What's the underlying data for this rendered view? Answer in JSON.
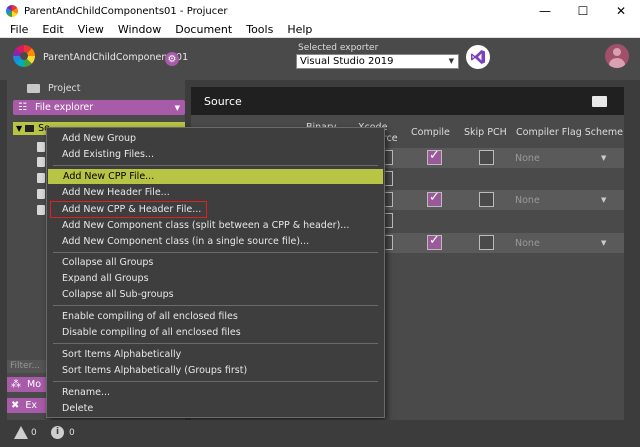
{
  "window": {
    "title": "ParentAndChildComponents01 - Projucer",
    "min": "—",
    "max": "☐",
    "close": "✕"
  },
  "menu": [
    "File",
    "Edit",
    "View",
    "Window",
    "Document",
    "Tools",
    "Help"
  ],
  "header": {
    "project_name": "ParentAndChildComponents01",
    "exporter_label": "Selected exporter",
    "exporter_value": "Visual Studio 2019"
  },
  "sidebar": {
    "project_label": "Project",
    "file_explorer_label": "File explorer",
    "group_label_partial": "So",
    "filter_placeholder": "Filter...",
    "bottom_tab1": "Mo",
    "bottom_tab2": "Ex"
  },
  "main": {
    "source_title": "Source",
    "columns": {
      "binary": "Binary",
      "xcode": "Xcode",
      "resource": "ource",
      "compile": "Compile",
      "skip_pch": "Skip PCH",
      "scheme": "Compiler Flag Scheme"
    },
    "rows": [
      {
        "compile": true,
        "skip_pch": false,
        "scheme": "None"
      },
      {
        "compile": true,
        "skip_pch": false,
        "scheme": "None"
      },
      {
        "compile": true,
        "skip_pch": false,
        "scheme": "None"
      }
    ]
  },
  "context_menu": {
    "items": [
      "Add New Group",
      "Add Existing Files...",
      "Add New CPP File...",
      "Add New Header File...",
      "Add New CPP & Header File...",
      "Add New Component class (split between a CPP & header)...",
      "Add New Component class (in a single source file)...",
      "Collapse all Groups",
      "Expand all Groups",
      "Collapse all Sub-groups",
      "Enable compiling of all enclosed files",
      "Disable compiling of all enclosed files",
      "Sort Items Alphabetically",
      "Sort Items Alphabetically (Groups first)",
      "Rename...",
      "Delete"
    ],
    "highlighted": "Add New CPP File...",
    "outlined": "Add New CPP & Header File..."
  },
  "status": {
    "warnings": "0",
    "infos": "0"
  },
  "colors": {
    "accent_purple": "#a85ba8",
    "highlight_green": "#b8c544",
    "outline_red": "#e02020"
  }
}
